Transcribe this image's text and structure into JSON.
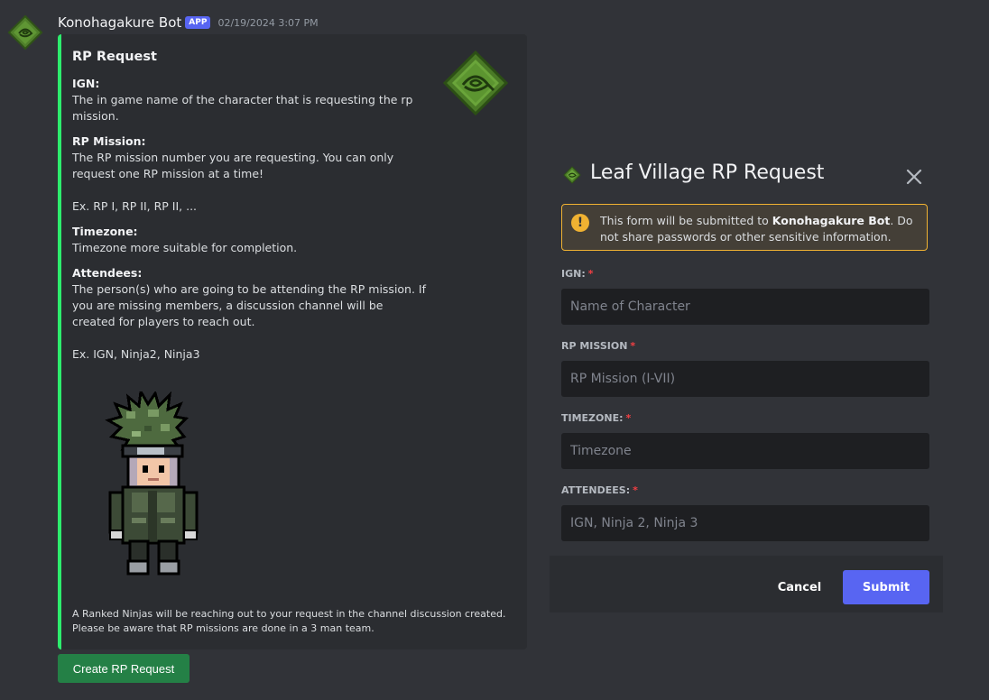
{
  "message": {
    "bot_name": "Konohagakure Bot",
    "badge": "APP",
    "timestamp": "02/19/2024 3:07 PM"
  },
  "embed": {
    "accent_color": "#2ded6d",
    "title": "RP Request",
    "fields": [
      {
        "name": "IGN:",
        "value": [
          "The in game name of the character that is requesting the rp mission."
        ]
      },
      {
        "name": "RP Mission:",
        "value": [
          "The RP mission number you are requesting. You can only request one RP mission at a time!",
          "Ex. RP I, RP II, RP II, ..."
        ]
      },
      {
        "name": "Timezone:",
        "value": [
          "Timezone more suitable for completion."
        ]
      },
      {
        "name": "Attendees:",
        "value": [
          "The person(s) who are going to be attending the RP mission. If you are missing members, a discussion channel will be created for players to reach out.",
          "Ex. IGN, Ninja2, Ninja3"
        ]
      }
    ],
    "footer": "A Ranked Ninjas will be reaching out to your request in the channel discussion created. Please be aware that RP missions are done in a 3 man team."
  },
  "action_button": {
    "label": "Create RP Request",
    "color": "#248046"
  },
  "modal": {
    "title": "Leaf Village RP Request",
    "warning": {
      "prefix": "This form will be submitted to ",
      "bot": "Konohagakure Bot",
      "suffix": ". Do not share passwords or other sensitive information."
    },
    "fields": [
      {
        "label": "IGN:",
        "placeholder": "Name of Character",
        "value": ""
      },
      {
        "label": "RP MISSION",
        "placeholder": "RP Mission (I-VII)",
        "value": ""
      },
      {
        "label": "TIMEZONE:",
        "placeholder": "Timezone",
        "value": ""
      },
      {
        "label": "ATTENDEES:",
        "placeholder": "IGN, Ninja 2, Ninja 3",
        "value": ""
      }
    ],
    "required_marker": "*",
    "cancel_label": "Cancel",
    "submit_label": "Submit",
    "submit_color": "#5865f2"
  },
  "icons": {
    "avatar": "leaf-village-emblem-icon",
    "thumbnail": "leaf-village-emblem-icon",
    "warning": "exclamation-icon",
    "close": "close-icon"
  }
}
